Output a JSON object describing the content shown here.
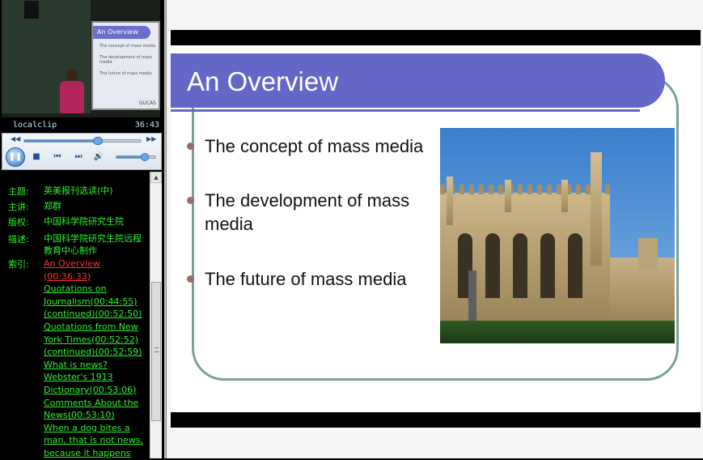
{
  "player": {
    "clip_name": "localclip",
    "elapsed": "36:43",
    "seek_progress": 0.62,
    "volume": 0.7,
    "video_slide_title": "An Overview",
    "video_slide_lines": [
      "The concept of mass media",
      "The development of mass media",
      "The future of mass media"
    ],
    "video_watermark": "GUCAS"
  },
  "info": {
    "topic_label": "主题:",
    "topic_value": "英美报刊选读(中)",
    "speaker_label": "主讲:",
    "speaker_value": "郑群",
    "copyright_label": "版权:",
    "copyright_value": "中国科学院研究生院",
    "desc_label": "描述:",
    "desc_value": "中国科学院研究生院远程教育中心制作",
    "index_label": "索引:"
  },
  "index_links": [
    {
      "text": "An Overview (00:36:33)",
      "active": true
    },
    {
      "text": "Quotations on Journalism(00:44:55)",
      "active": false
    },
    {
      "text": "(continued)(00:52:50)",
      "active": false
    },
    {
      "text": "Quotations from New York Times(00:52:52)",
      "active": false
    },
    {
      "text": "(continued)(00:52:59)",
      "active": false
    },
    {
      "text": "What is news? Webster's 1913 Dictionary(00:53:06)",
      "active": false
    },
    {
      "text": "Comments About the News(00:53:10)",
      "active": false
    },
    {
      "text": "When a dog bites a man, that is not news, because it happens",
      "active": false
    }
  ],
  "slide": {
    "title": "An Overview",
    "bullets": [
      "The concept of mass media",
      "The development of mass media",
      "The future of mass media"
    ],
    "accent_color": "#6466c8",
    "frame_color": "#7a9f9a",
    "bullet_color": "#9a6e68"
  }
}
